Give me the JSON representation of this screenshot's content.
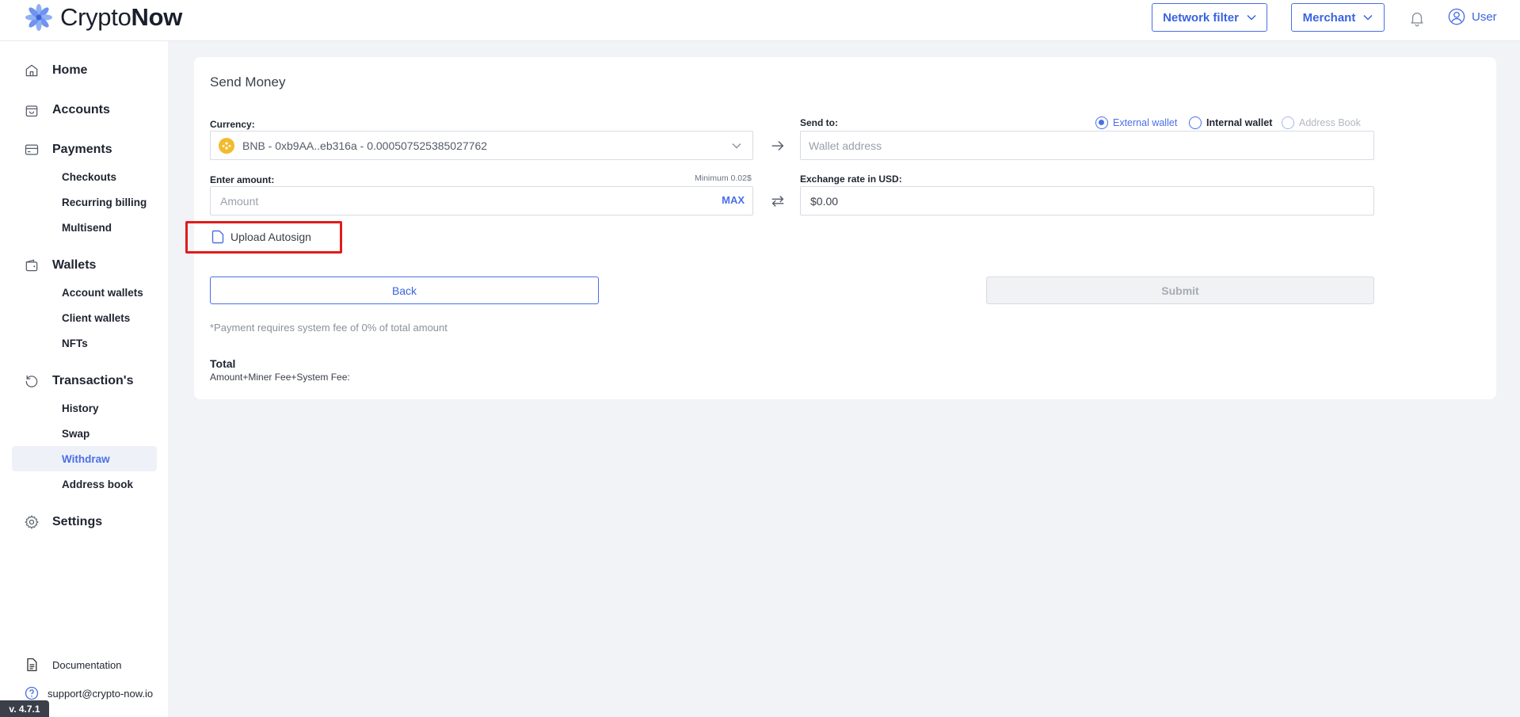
{
  "header": {
    "logo_light": "Crypto",
    "logo_bold": "Now",
    "network_filter_label": "Network filter",
    "merchant_label": "Merchant",
    "user_label": "User"
  },
  "sidebar": {
    "home": "Home",
    "accounts": "Accounts",
    "payments": "Payments",
    "payments_items": [
      "Checkouts",
      "Recurring billing",
      "Multisend"
    ],
    "wallets": "Wallets",
    "wallets_items": [
      "Account wallets",
      "Client wallets",
      "NFTs"
    ],
    "transactions": "Transaction's",
    "transactions_items": [
      "History",
      "Swap",
      "Withdraw",
      "Address book"
    ],
    "active_item": "Withdraw",
    "settings": "Settings",
    "documentation": "Documentation",
    "support": "support@crypto-now.io",
    "version": "v. 4.7.1"
  },
  "form": {
    "title": "Send Money",
    "currency_label": "Currency:",
    "currency_value": "BNB - 0xb9AA..eb316a - 0.000507525385027762",
    "send_to_label": "Send to:",
    "radio_options": [
      "External wallet",
      "Internal wallet",
      "Address Book"
    ],
    "radio_selected": "External wallet",
    "wallet_address_placeholder": "Wallet address",
    "enter_amount_label": "Enter amount:",
    "minimum_note": "Minimum 0.02$",
    "amount_placeholder": "Amount",
    "max_label": "MAX",
    "exchange_rate_label": "Exchange rate in USD:",
    "exchange_rate_value": "$0.00",
    "upload_autosign_label": "Upload Autosign",
    "back_label": "Back",
    "submit_label": "Submit",
    "fee_note": "*Payment requires system fee of 0% of total amount",
    "total_label": "Total",
    "total_sub": "Amount+Miner Fee+System Fee:"
  },
  "colors": {
    "accent": "#4a6fe8",
    "bnb": "#f3ba2f",
    "highlight": "#e21b1b",
    "background": "#f1f3f7"
  },
  "icons": {
    "logo": "crypto-now-flower-icon",
    "home": "home-icon",
    "accounts": "shopping-bag-icon",
    "payments": "credit-card-icon",
    "wallets": "wallet-icon",
    "transactions": "history-icon",
    "settings": "gear-icon",
    "documentation": "document-icon",
    "support": "help-icon",
    "upload": "file-icon"
  }
}
